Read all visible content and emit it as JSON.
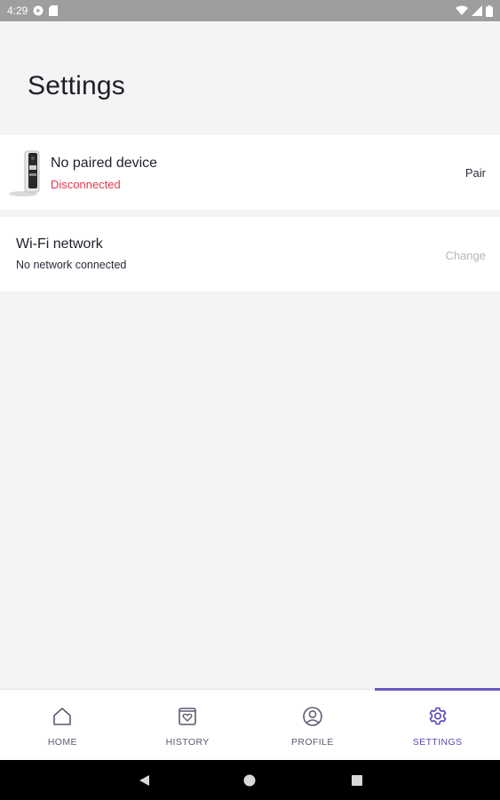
{
  "status_bar": {
    "time": "4:29",
    "icons": [
      "google-play-icon",
      "sd-card-icon",
      "wifi-icon",
      "signal-icon",
      "battery-icon"
    ]
  },
  "header": {
    "title": "Settings"
  },
  "device": {
    "name": "No paired device",
    "status": "Disconnected",
    "status_color": "#e5384e",
    "action": "Pair",
    "icon": "camera-device-icon"
  },
  "wifi": {
    "title": "Wi-Fi network",
    "status": "No network connected",
    "action": "Change",
    "action_enabled": false
  },
  "bottom_nav": {
    "accent": "#5b46b8",
    "active": "settings",
    "items": [
      {
        "label": "HOME",
        "icon": "home-icon"
      },
      {
        "label": "HISTORY",
        "icon": "history-heart-icon"
      },
      {
        "label": "PROFILE",
        "icon": "profile-icon"
      },
      {
        "label": "SETTINGS",
        "icon": "gear-icon"
      }
    ]
  },
  "system_nav": {
    "buttons": [
      "back-icon",
      "home-circle-icon",
      "recents-icon"
    ]
  }
}
